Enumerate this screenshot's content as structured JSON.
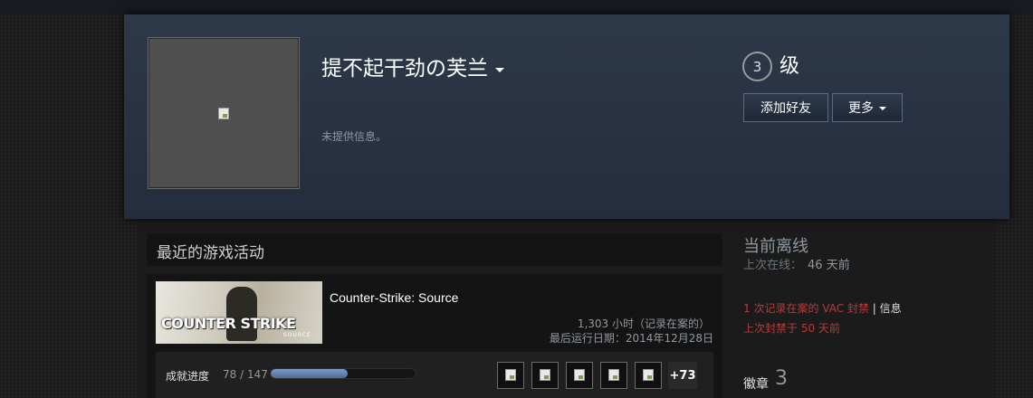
{
  "profile": {
    "persona_name": "提不起干劲の芙兰",
    "summary": "未提供信息。",
    "level_number": "3",
    "level_label": "级",
    "add_friend_label": "添加好友",
    "more_label": "更多"
  },
  "recent_activity": {
    "title": "最近的游戏活动",
    "game": {
      "name": "Counter-Strike: Source",
      "capsule_logo": "COUNTER STRIKE",
      "capsule_sub": "SOURCE",
      "hours": "1,303 小时（记录在案的）",
      "last_played": "最后运行日期：2014年12月28日",
      "achievements": {
        "label": "成就进度",
        "count": "78 / 147",
        "progress_fraction": 0.53,
        "more": "+73",
        "icons": [
          "achievement-1",
          "achievement-2",
          "achievement-3",
          "achievement-4",
          "achievement-5"
        ]
      }
    }
  },
  "status": {
    "title": "当前离线",
    "last_online_label": "上次在线：",
    "last_online_value": "46 天前",
    "vac_text": "1 次记录在案的 VAC 封禁",
    "vac_separator": " | ",
    "vac_info": "信息",
    "ban_date": "上次封禁于 50 天前"
  },
  "badges": {
    "label": "徽章",
    "count": "3"
  },
  "colors": {
    "header_bg": "#2d3849",
    "vac_red": "#b83b3b",
    "progress_blue": "#6b8ab8"
  }
}
